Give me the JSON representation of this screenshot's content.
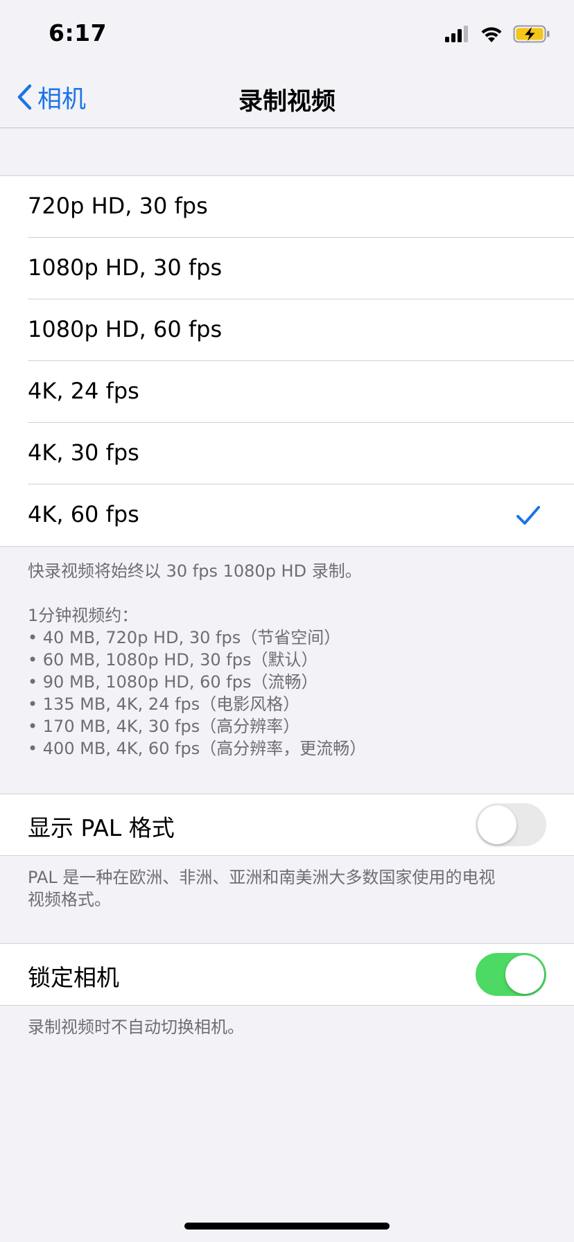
{
  "status_bar": {
    "time": "6:17",
    "icons": [
      "cellular-signal-icon",
      "wifi-icon",
      "battery-charging-icon"
    ]
  },
  "nav": {
    "back_label": "相机",
    "title": "录制视频"
  },
  "options": [
    {
      "label": "720p HD, 30 fps",
      "selected": false
    },
    {
      "label": "1080p HD, 30 fps",
      "selected": false
    },
    {
      "label": "1080p HD, 60 fps",
      "selected": false
    },
    {
      "label": "4K, 24 fps",
      "selected": false
    },
    {
      "label": "4K, 30 fps",
      "selected": false
    },
    {
      "label": "4K, 60 fps",
      "selected": true
    }
  ],
  "options_footer": {
    "quick_record_note": "快录视频将始终以 30 fps 1080p HD 录制。",
    "size_heading": "1分钟视频约：",
    "sizes": [
      "• 40 MB, 720p HD, 30 fps（节省空间）",
      "• 60 MB, 1080p HD, 30 fps（默认）",
      "• 90 MB, 1080p HD, 60 fps（流畅）",
      "• 135 MB, 4K, 24 fps（电影风格）",
      "• 170 MB, 4K, 30 fps（高分辨率）",
      "• 400 MB, 4K, 60 fps（高分辨率，更流畅）"
    ]
  },
  "pal": {
    "label": "显示 PAL 格式",
    "enabled": false,
    "footer_lines": [
      "PAL 是一种在欧洲、非洲、亚洲和南美洲大多数国家使用的电视",
      "视频格式。"
    ]
  },
  "lock_camera": {
    "label": "锁定相机",
    "enabled": true,
    "footer": "录制视频时不自动切换相机。"
  },
  "colors": {
    "accent": "#1a73e8",
    "toggle_on": "#4cd964",
    "background": "#f2f2f7"
  }
}
